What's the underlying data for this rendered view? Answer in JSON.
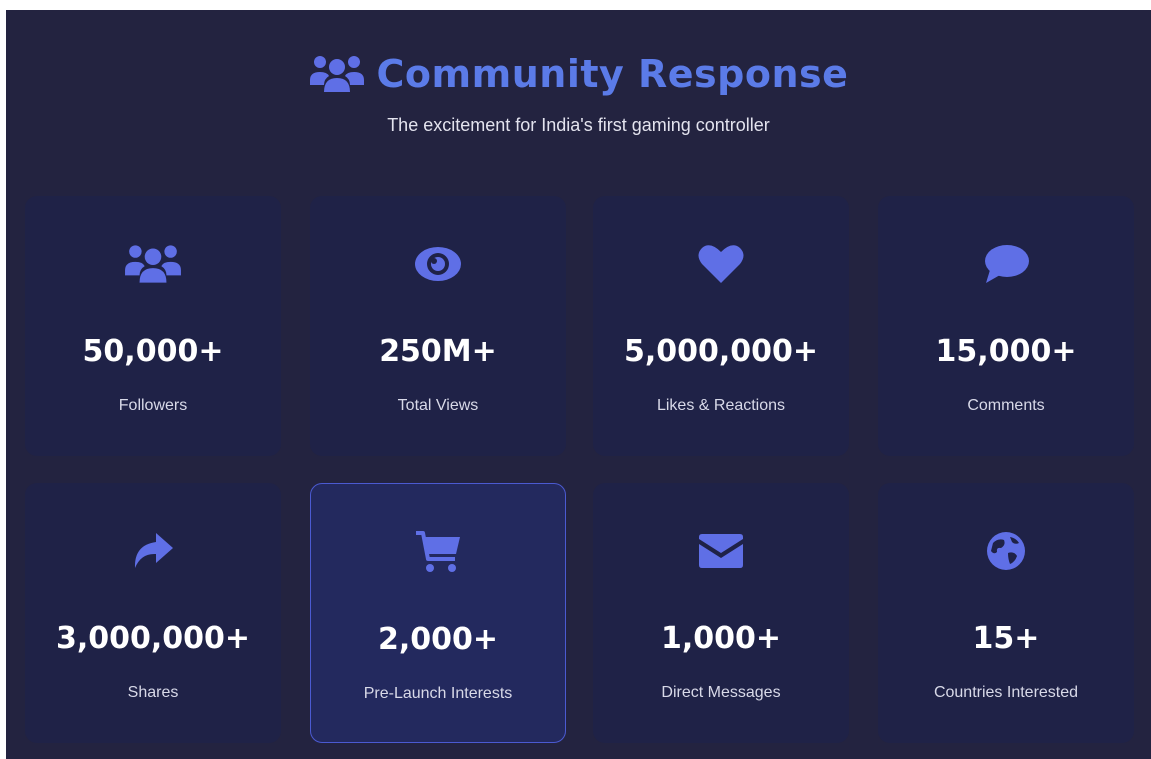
{
  "header": {
    "title": "Community Response",
    "subtitle": "The excitement for India's first gaming controller",
    "icon": "users-icon"
  },
  "colors": {
    "accent": "#5b7be8",
    "icon": "#5f6fe6",
    "panel_bg": "#232340",
    "card_bg": "#1f2247",
    "card_highlight_bg": "#23295e",
    "card_highlight_border": "#4b5ad1"
  },
  "stats": [
    {
      "icon": "users-icon",
      "value": "50,000+",
      "label": "Followers"
    },
    {
      "icon": "eye-icon",
      "value": "250M+",
      "label": "Total Views"
    },
    {
      "icon": "heart-icon",
      "value": "5,000,000+",
      "label": "Likes & Reactions"
    },
    {
      "icon": "comment-icon",
      "value": "15,000+",
      "label": "Comments"
    },
    {
      "icon": "share-icon",
      "value": "3,000,000+",
      "label": "Shares"
    },
    {
      "icon": "cart-icon",
      "value": "2,000+",
      "label": "Pre-Launch Interests",
      "highlighted": true
    },
    {
      "icon": "envelope-icon",
      "value": "1,000+",
      "label": "Direct Messages"
    },
    {
      "icon": "globe-icon",
      "value": "15+",
      "label": "Countries Interested"
    }
  ]
}
